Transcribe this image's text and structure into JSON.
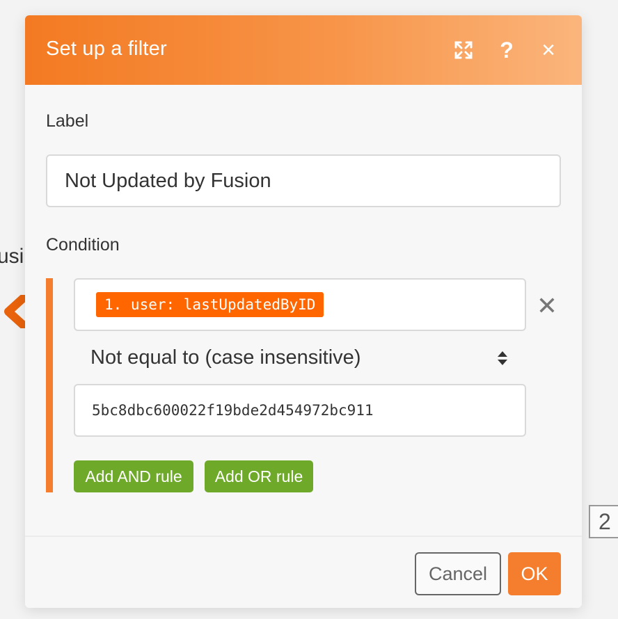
{
  "background": {
    "partial_text": "usi",
    "badge_number": "2"
  },
  "modal": {
    "title": "Set up a filter",
    "header_icons": [
      "expand-icon",
      "help-icon",
      "close-icon"
    ],
    "help_glyph": "?",
    "close_glyph": "×",
    "label_heading": "Label",
    "label_value": "Not Updated by Fusion",
    "condition_heading": "Condition",
    "condition": {
      "operand": "1. user: lastUpdatedByID",
      "remove_glyph": "✕",
      "operator": "Not equal to (case insensitive)",
      "value": "5bc8dbc600022f19bde2d454972bc911"
    },
    "add_and_label": "Add AND rule",
    "add_or_label": "Add OR rule",
    "cancel_label": "Cancel",
    "ok_label": "OK"
  },
  "colors": {
    "header_start": "#f37a22",
    "header_end": "#fbb57c",
    "accent_orange": "#f47e2e",
    "pill_orange": "#ff6600",
    "rule_green": "#6ea92a"
  }
}
